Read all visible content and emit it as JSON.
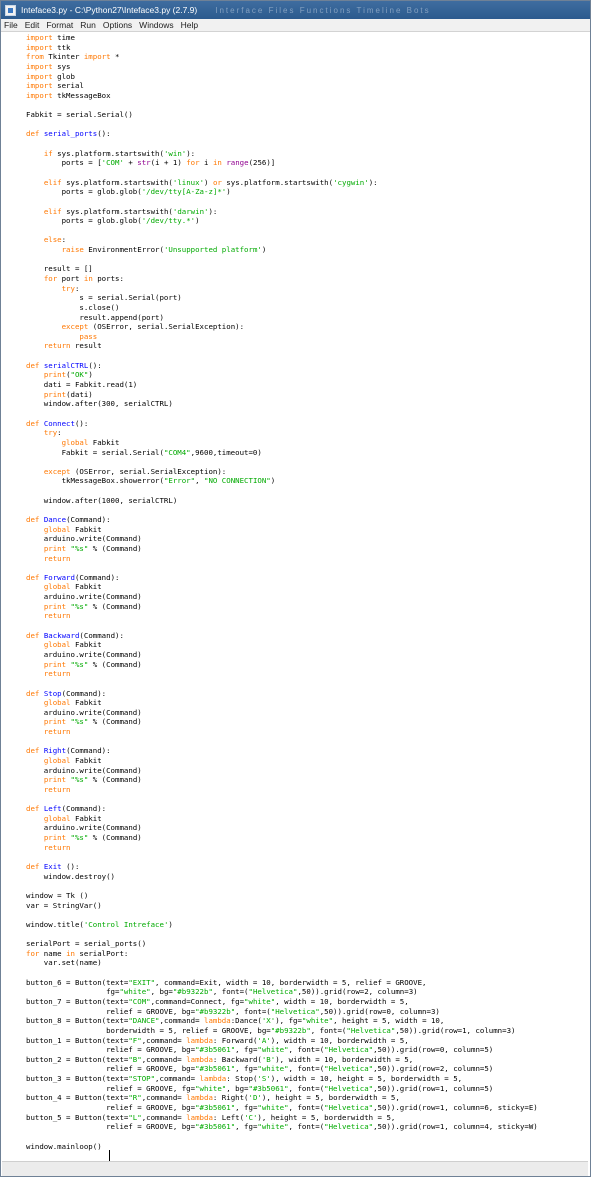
{
  "window": {
    "title": "Inteface3.py - C:\\Python27\\Inteface3.py (2.7.9)",
    "title_faint": "Interface Files Functions Timeline Bots",
    "icon": "python-file-icon"
  },
  "menu": [
    "File",
    "Edit",
    "Format",
    "Run",
    "Options",
    "Windows",
    "Help"
  ],
  "code_lines": [
    "import time",
    "import ttk",
    "from Tkinter import *",
    "import sys",
    "import glob",
    "import serial",
    "import tkMessageBox",
    "",
    "Fabkit = serial.Serial()",
    "",
    "def serial_ports():",
    "",
    "    if sys.platform.startswith('win'):",
    "        ports = ['COM' + str(i + 1) for i in range(256)]",
    "",
    "    elif sys.platform.startswith('linux') or sys.platform.startswith('cygwin'):",
    "        ports = glob.glob('/dev/tty[A-Za-z]*')",
    "",
    "    elif sys.platform.startswith('darwin'):",
    "        ports = glob.glob('/dev/tty.*')",
    "",
    "    else:",
    "        raise EnvironmentError('Unsupported platform')",
    "",
    "    result = []",
    "    for port in ports:",
    "        try:",
    "            s = serial.Serial(port)",
    "            s.close()",
    "            result.append(port)",
    "        except (OSError, serial.SerialException):",
    "            pass",
    "    return result",
    "",
    "def serialCTRL():",
    "    print(\"OK\")",
    "    dati = Fabkit.read(1)",
    "    print(dati)",
    "    window.after(300, serialCTRL)",
    "",
    "def Connect():",
    "    try:",
    "        global Fabkit",
    "        Fabkit = serial.Serial(\"COM4\",9600,timeout=0)",
    "",
    "    except (OSError, serial.SerialException):",
    "        tkMessageBox.showerror(\"Error\", \"NO CONNECTION\")",
    "",
    "    window.after(1000, serialCTRL)",
    "",
    "def Dance(Command):",
    "    global Fabkit",
    "    arduino.write(Command)",
    "    print \"%s\" % (Command)",
    "    return",
    "",
    "def Forward(Command):",
    "    global Fabkit",
    "    arduino.write(Command)",
    "    print \"%s\" % (Command)",
    "    return",
    "",
    "def Backward(Command):",
    "    global Fabkit",
    "    arduino.write(Command)",
    "    print \"%s\" % (Command)",
    "    return",
    "",
    "def Stop(Command):",
    "    global Fabkit",
    "    arduino.write(Command)",
    "    print \"%s\" % (Command)",
    "    return",
    "",
    "def Right(Command):",
    "    global Fabkit",
    "    arduino.write(Command)",
    "    print \"%s\" % (Command)",
    "    return",
    "",
    "def Left(Command):",
    "    global Fabkit",
    "    arduino.write(Command)",
    "    print \"%s\" % (Command)",
    "    return",
    "",
    "def Exit ():",
    "    window.destroy()",
    "",
    "window = Tk ()",
    "var = StringVar()",
    "",
    "window.title('Control Intreface')",
    "",
    "serialPort = serial_ports()",
    "for name in serialPort:",
    "    var.set(name)",
    "",
    "button_6 = Button(text=\"EXIT\", command=Exit, width = 10, borderwidth = 5, relief = GROOVE,",
    "                  fg=\"white\", bg=\"#b9322b\", font=(\"Helvetica\",50)).grid(row=2, column=3)",
    "button_7 = Button(text=\"COM\",command=Connect, fg=\"white\", width = 10, borderwidth = 5,",
    "                  relief = GROOVE, bg=\"#b9322b\", font=(\"Helvetica\",50)).grid(row=0, column=3)",
    "button_8 = Button(text=\"DANCE\",command= lambda:Dance('X'), fg=\"white\", height = 5, width = 10,",
    "                  borderwidth = 5, relief = GROOVE, bg=\"#b9322b\", font=(\"Helvetica\",50)).grid(row=1, column=3)",
    "button_1 = Button(text=\"F\",command= lambda: Forward('A'), width = 10, borderwidth = 5,",
    "                  relief = GROOVE, bg=\"#3b5061\", fg=\"white\", font=(\"Helvetica\",50)).grid(row=0, column=5)",
    "button_2 = Button(text=\"B\",command= lambda: Backward('B'), width = 10, borderwidth = 5,",
    "                  relief = GROOVE, bg=\"#3b5061\", fg=\"white\", font=(\"Helvetica\",50)).grid(row=2, column=5)",
    "button_3 = Button(text=\"STOP\",command= lambda: Stop('S'), width = 10, height = 5, borderwidth = 5,",
    "                  relief = GROOVE, fg=\"white\", bg=\"#3b5061\", font=(\"Helvetica\",50)).grid(row=1, column=5)",
    "button_4 = Button(text=\"R\",command= lambda: Right('D'), height = 5, borderwidth = 5,",
    "                  relief = GROOVE, bg=\"#3b5061\", fg=\"white\", font=(\"Helvetica\",50)).grid(row=1, column=6, sticky=E)",
    "button_5 = Button(text=\"L\",command= lambda: Left('C'), height = 5, borderwidth = 5,",
    "                  relief = GROOVE, bg=\"#3b5061\", fg=\"white\", font=(\"Helvetica\",50)).grid(row=1, column=4, sticky=W)",
    "",
    "window.mainloop()"
  ],
  "syntax_colors": {
    "keyword": "#ff7700",
    "builtin": "#900090",
    "string": "#00aa00",
    "definition": "#0000ff"
  }
}
